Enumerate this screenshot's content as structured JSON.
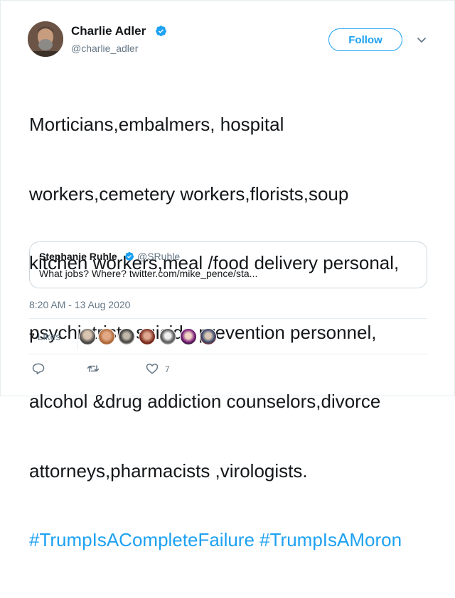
{
  "author": {
    "name": "Charlie Adler",
    "handle": "@charlie_adler",
    "verified": true
  },
  "follow_label": "Follow",
  "tweet": {
    "lines": [
      "Morticians,embalmers, hospital",
      "workers,cemetery workers,florists,soup",
      "kitchen workers,meal /food delivery personal,",
      "psychiatrists,suicide prevention personnel,",
      "alcohol &drug addiction counselors,divorce",
      "attorneys,pharmacists ,virologists."
    ],
    "hashtags": [
      "#TrumpIsACompleteFailure",
      "#TrumpIsAMoron"
    ]
  },
  "quoted_tweet": {
    "name": "Stephanie Ruhle",
    "handle": "@SRuhle",
    "text": "What jobs? Where? twitter.com/mike_pence/sta..."
  },
  "timestamp": "8:20 AM - 13 Aug 2020",
  "likes": {
    "count": "7",
    "label": "Likes"
  },
  "actions": {
    "reply_icon": "reply-icon",
    "retweet_icon": "retweet-icon",
    "like_icon": "heart-icon",
    "like_count": "7"
  },
  "colors": {
    "accent": "#1da1f2",
    "text": "#14171a",
    "secondary": "#657786",
    "border": "#e6ecf0"
  }
}
